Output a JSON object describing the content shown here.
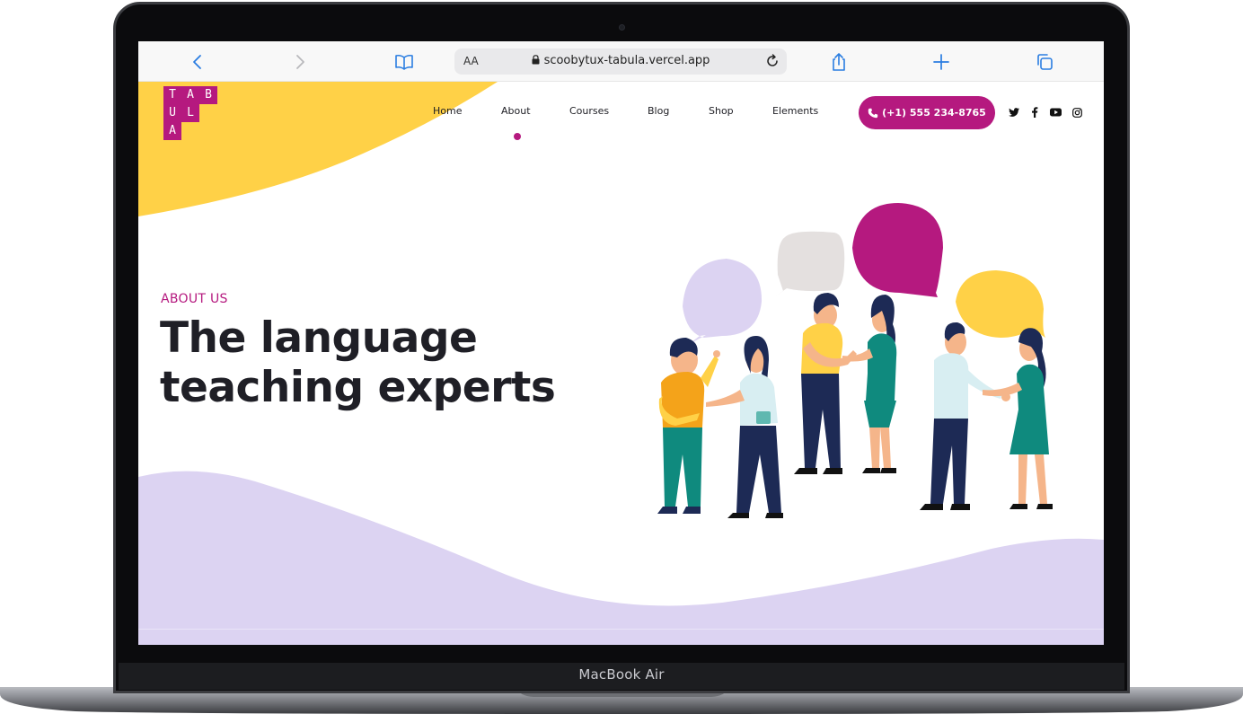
{
  "device": {
    "model_label": "MacBook Air"
  },
  "browser": {
    "text_size_label": "AA",
    "url": "scoobytux-tabula.vercel.app",
    "icons": [
      "back-icon",
      "forward-icon",
      "bookmarks-icon",
      "lock-icon",
      "reload-icon",
      "share-icon",
      "new-tab-icon",
      "tabs-icon"
    ]
  },
  "site": {
    "logo_letters": [
      "T",
      "A",
      "B",
      "U",
      "L",
      "A"
    ],
    "nav": [
      {
        "label": "Home"
      },
      {
        "label": "About"
      },
      {
        "label": "Courses"
      },
      {
        "label": "Blog"
      },
      {
        "label": "Shop"
      },
      {
        "label": "Elements"
      }
    ],
    "active_nav": "About",
    "phone_label": "(+1) 555 234-8765",
    "social_icons": [
      "twitter-icon",
      "facebook-icon",
      "youtube-icon",
      "instagram-icon"
    ]
  },
  "hero": {
    "eyebrow": "ABOUT US",
    "headline_line1": "The language",
    "headline_line2": "teaching experts"
  },
  "colors": {
    "brand_magenta": "#b5197f",
    "accent_yellow": "#ffd147",
    "lavender": "#dcd3f2",
    "text_dark": "#1f1f26",
    "teal": "#0f8a7e",
    "navy": "#1d2a55"
  }
}
